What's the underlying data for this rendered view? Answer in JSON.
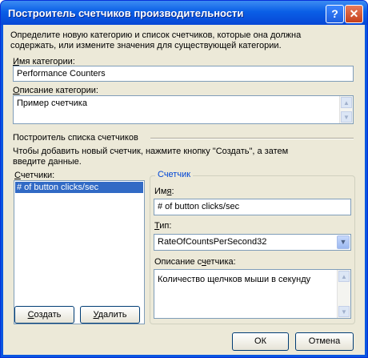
{
  "window": {
    "title": "Построитель счетчиков производительности"
  },
  "title_buttons": {
    "help": "?",
    "close": "✕"
  },
  "intro_text_line1": "Определите новую категорию и список счетчиков, которые она должна",
  "intro_text_line2": "содержать, или измените значения для существующей категории.",
  "category_name": {
    "label_u": "И",
    "label_rest": "мя категории:",
    "value": "Performance Counters"
  },
  "category_desc": {
    "label_u": "О",
    "label_rest": "писание категории:",
    "value": "Пример счетчика"
  },
  "list_builder": {
    "title": "Построитель списка счетчиков",
    "hint_line1": "Чтобы добавить новый счетчик, нажмите кнопку \"Создать\", а затем",
    "hint_line2": "введите данные."
  },
  "counters": {
    "label_u": "С",
    "label_rest": "четчики:",
    "items": [
      "# of button clicks/sec"
    ]
  },
  "buttons": {
    "create_u": "С",
    "create_rest": "оздать",
    "delete_u": "У",
    "delete_rest": "далить",
    "ok": "ОК",
    "cancel": "Отмена"
  },
  "counter_group": {
    "title": "Счетчик",
    "name_label_pre": "Им",
    "name_label_u": "я",
    "name_label_post": ":",
    "name_value": "# of button clicks/sec",
    "type_label_u": "Т",
    "type_label_rest": "ип:",
    "type_value": "RateOfCountsPerSecond32",
    "desc_label_pre": "Описание с",
    "desc_label_u": "ч",
    "desc_label_post": "етчика:",
    "desc_value": "Количество щелчков мыши в секунду"
  },
  "icons": {
    "scroll_up": "scroll-up-arrow-icon",
    "scroll_down": "scroll-down-arrow-icon",
    "dropdown": "chevron-down-icon"
  }
}
